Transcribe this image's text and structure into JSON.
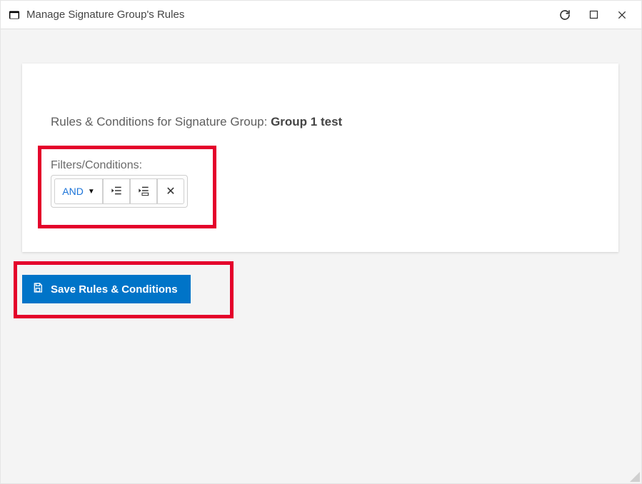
{
  "window": {
    "title": "Manage Signature Group's Rules"
  },
  "card": {
    "heading_prefix": "Rules & Conditions for Signature Group: ",
    "group_name": "Group 1 test",
    "filters_label": "Filters/Conditions:",
    "operator": "AND"
  },
  "buttons": {
    "save_label": "Save Rules & Conditions"
  }
}
